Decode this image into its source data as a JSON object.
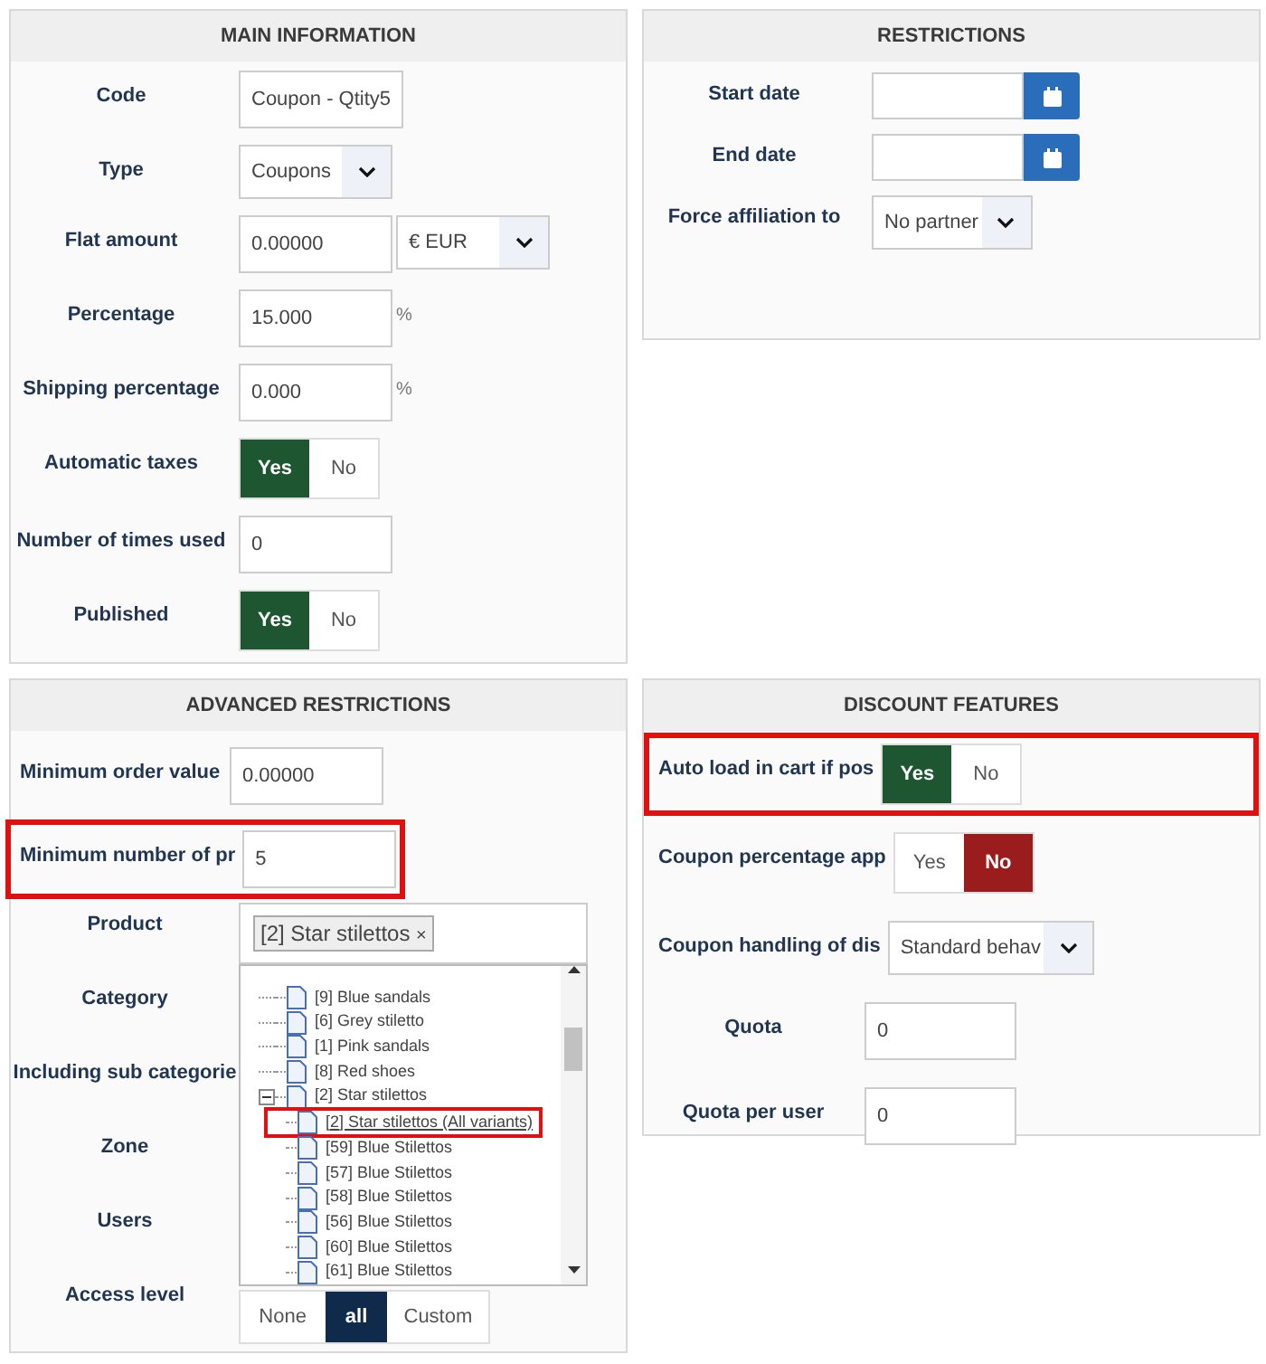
{
  "main_information": {
    "title": "MAIN INFORMATION",
    "fields": [
      {
        "kind": "text",
        "label": "Code",
        "value": "Coupon - Qtity5"
      },
      {
        "kind": "select",
        "label": "Type",
        "value": "Coupons"
      },
      {
        "kind": "amount",
        "label": "Flat amount",
        "value": "0.00000",
        "currency": "€ EUR"
      },
      {
        "kind": "percent",
        "label": "Percentage",
        "value": "15.000",
        "unit": "%"
      },
      {
        "kind": "percent",
        "label": "Shipping percentage",
        "value": "0.000",
        "unit": "%"
      },
      {
        "kind": "toggle",
        "label": "Automatic taxes",
        "options": [
          {
            "label": "Yes",
            "selected": true
          },
          {
            "label": "No",
            "selected": false
          }
        ]
      },
      {
        "kind": "text",
        "label": "Number of times used",
        "value": "0"
      },
      {
        "kind": "toggle",
        "label": "Published",
        "options": [
          {
            "label": "Yes",
            "selected": true
          },
          {
            "label": "No",
            "selected": false
          }
        ]
      }
    ]
  },
  "restrictions": {
    "title": "RESTRICTIONS",
    "fields": [
      {
        "kind": "date",
        "label": "Start date"
      },
      {
        "kind": "date",
        "label": "End date"
      },
      {
        "kind": "select",
        "label": "Force affiliation to",
        "value": "No partner"
      }
    ]
  },
  "advanced_restrictions": {
    "title": "ADVANCED RESTRICTIONS",
    "fields": [
      {
        "kind": "text",
        "label": "Minimum order value",
        "value": "0.00000",
        "highlighted": false
      },
      {
        "kind": "text",
        "label": "Minimum number of pr",
        "value": "5",
        "highlighted": true
      }
    ],
    "labels": [
      "Product",
      "Category",
      "Including sub categorie",
      "Zone",
      "Users",
      "Access level"
    ],
    "product_tags": [
      {
        "label": "[2] Star stilettos",
        "remove": "×"
      }
    ],
    "tree": [
      {
        "label": "[9] Blue sandals",
        "expanded": false,
        "highlighted": false
      },
      {
        "label": "[6] Grey stiletto",
        "expanded": false,
        "highlighted": false
      },
      {
        "label": "[1] Pink sandals",
        "expanded": false,
        "highlighted": false
      },
      {
        "label": "[8] Red shoes",
        "expanded": false,
        "highlighted": false
      },
      {
        "label": "[2] Star stilettos",
        "expanded": true,
        "highlighted": false,
        "children": [
          {
            "label": "[2] Star stilettos (All variants)",
            "highlighted": true
          },
          {
            "label": "[59] Blue Stilettos",
            "highlighted": false
          },
          {
            "label": "[57] Blue Stilettos",
            "highlighted": false
          },
          {
            "label": "[58] Blue Stilettos",
            "highlighted": false
          },
          {
            "label": "[56] Blue Stilettos",
            "highlighted": false
          },
          {
            "label": "[60] Blue Stilettos",
            "highlighted": false
          },
          {
            "label": "[61] Blue Stilettos",
            "highlighted": false
          }
        ]
      }
    ],
    "access_level": [
      {
        "label": "None",
        "selected": false
      },
      {
        "label": "all",
        "selected": true
      },
      {
        "label": "Custom",
        "selected": false
      }
    ]
  },
  "discount_features": {
    "title": "DISCOUNT FEATURES",
    "fields": [
      {
        "kind": "toggle",
        "label": "Auto load in cart if pos",
        "highlighted": true,
        "options": [
          {
            "label": "Yes",
            "selected": true
          },
          {
            "label": "No",
            "selected": false
          }
        ]
      },
      {
        "kind": "toggle",
        "label": "Coupon percentage app",
        "highlighted": false,
        "options": [
          {
            "label": "Yes",
            "selected": false
          },
          {
            "label": "No",
            "selected": true
          }
        ]
      },
      {
        "kind": "select",
        "label": "Coupon handling of dis",
        "highlighted": false,
        "value": "Standard behav"
      },
      {
        "kind": "text",
        "label": "Quota",
        "highlighted": false,
        "value": "0"
      },
      {
        "kind": "text",
        "label": "Quota per user",
        "highlighted": false,
        "value": "0"
      }
    ]
  }
}
